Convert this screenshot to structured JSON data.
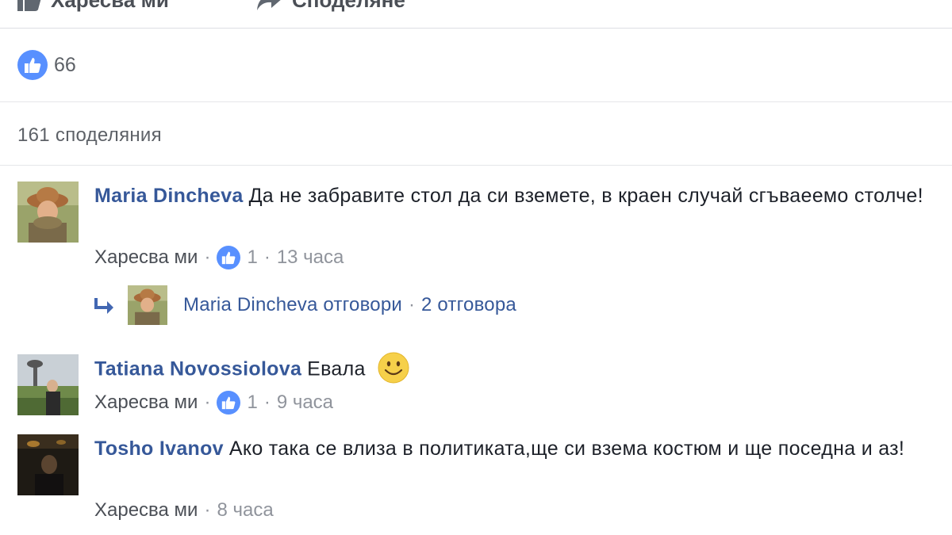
{
  "actions": {
    "like_label": "Харесва ми",
    "share_label": "Споделяне"
  },
  "reactions": {
    "count": "66"
  },
  "shares": {
    "label": "161 споделяния"
  },
  "comments": [
    {
      "author": "Maria Dincheva",
      "text": "Да не забравите стол да си вземете, в краен случай сгъваеемо столче!",
      "like_label": "Харесва ми",
      "like_count": "1",
      "time": "13 часа",
      "reply": {
        "author_text": "Maria Dincheva отговори",
        "count_text": "2 отговора"
      }
    },
    {
      "author": "Tatiana Novossiolova",
      "text": "Евала",
      "like_label": "Харесва ми",
      "like_count": "1",
      "time": "9 часа"
    },
    {
      "author": "Tosho Ivanov",
      "text": "Ако така се влиза в политиката,ще си взема костюм и ще поседна и аз!",
      "like_label": "Харесва ми",
      "time": "8 часа"
    }
  ],
  "colors": {
    "link_blue": "#365899",
    "like_blue": "#5890ff",
    "meta_gray": "#90949c"
  }
}
